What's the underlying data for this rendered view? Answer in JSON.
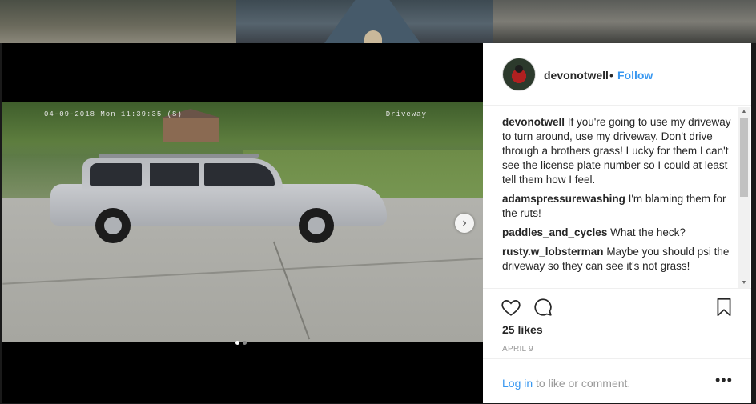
{
  "media": {
    "overlay_timestamp": "04-09-2018 Mon 11:39:35 (S)",
    "overlay_camera": "Driveway",
    "next_glyph": "›"
  },
  "post": {
    "username": "devonotwell",
    "separator": "•",
    "follow_label": "Follow"
  },
  "comments": [
    {
      "user": "devonotwell",
      "text": "If you're going to use my driveway to turn around, use my driveway. Don't drive through a brothers grass! Lucky for them I can't see the license plate number so I could at least tell them how I feel."
    },
    {
      "user": "adamspressurewashing",
      "text": "I'm blaming them for the ruts!"
    },
    {
      "user": "paddles_and_cycles",
      "text": "What the heck?"
    },
    {
      "user": "rusty.w_lobsterman",
      "text": "Maybe you should psi the driveway so they can see it's not grass!"
    }
  ],
  "scroll": {
    "up": "▲",
    "down": "▼"
  },
  "likes": "25 likes",
  "date": "APRIL 9",
  "footer": {
    "login_link": "Log in",
    "login_rest": " to like or comment.",
    "more": "•••"
  },
  "colors": {
    "accent": "#3897f0",
    "text": "#262626",
    "muted": "#999999"
  },
  "icons": [
    "heart-icon",
    "comment-icon",
    "bookmark-icon",
    "chevron-right-icon",
    "more-icon"
  ]
}
